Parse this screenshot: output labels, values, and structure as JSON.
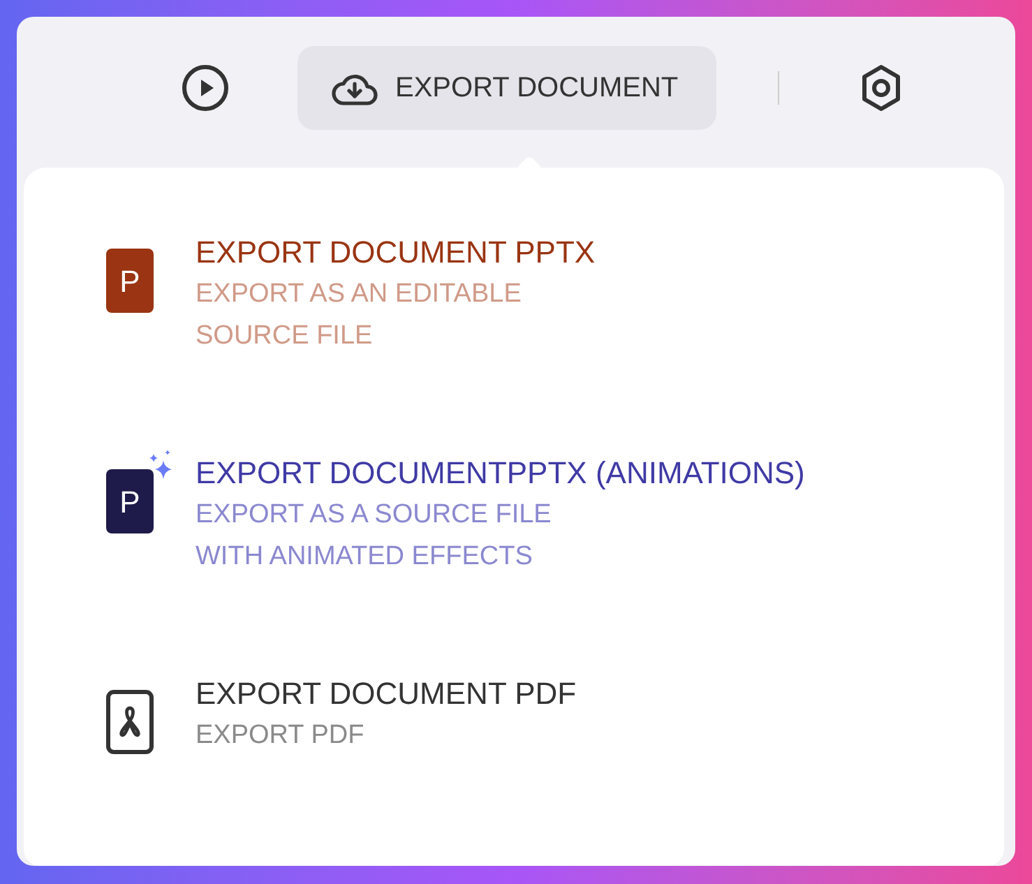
{
  "toolbar": {
    "export_button": "EXPORT DOCUMENT"
  },
  "export_menu": {
    "items": [
      {
        "kind": "pptx",
        "icon_letter": "P",
        "title": "EXPORT DOCUMENT PPTX",
        "description": "EXPORT AS AN EDITABLE SOURCE FILE"
      },
      {
        "kind": "pptx-animated",
        "icon_letter": "P",
        "title": "EXPORT DOCUMENTPPTX (ANIMATIONS)",
        "description": "EXPORT AS A SOURCE FILE WITH ANIMATED EFFECTS"
      },
      {
        "kind": "pdf",
        "title": "EXPORT DOCUMENT PDF",
        "description": "EXPORT PDF"
      }
    ]
  }
}
